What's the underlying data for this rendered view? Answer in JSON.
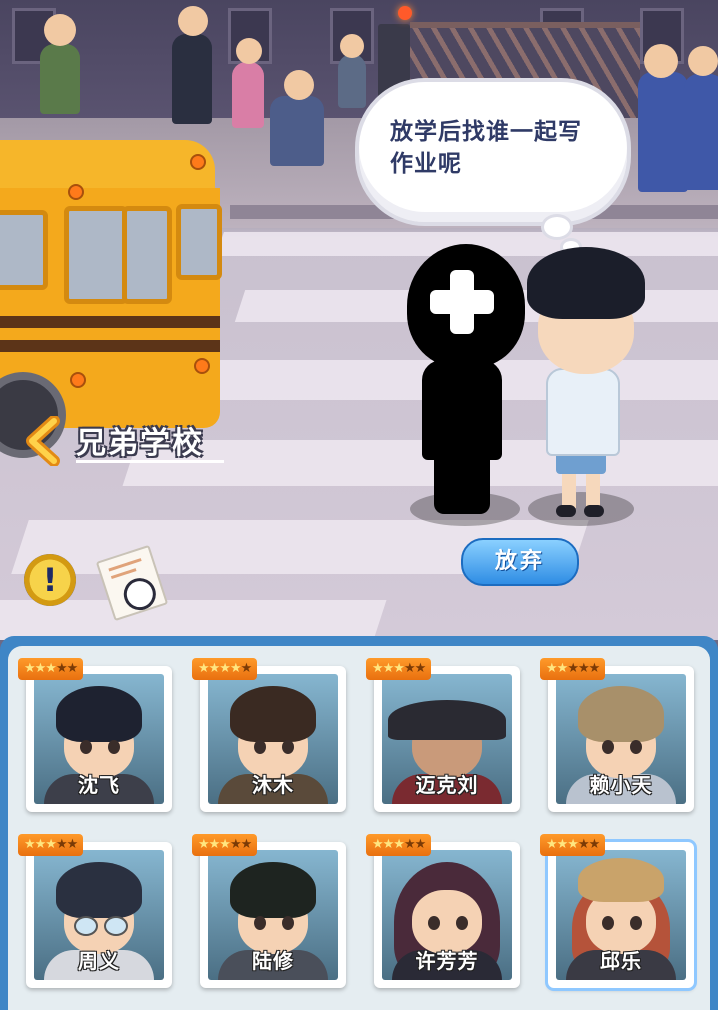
{
  "scene": {
    "location_label": "兄弟学校",
    "speech_bubble": "放学后找谁一起写作业呢",
    "give_up_label": "放弃",
    "info_button": "!"
  },
  "characters": [
    {
      "name": "沈飞",
      "stars": 5,
      "filled": 3
    },
    {
      "name": "沐木",
      "stars": 5,
      "filled": 4
    },
    {
      "name": "迈克刘",
      "stars": 5,
      "filled": 3
    },
    {
      "name": "赖小天",
      "stars": 5,
      "filled": 2
    },
    {
      "name": "周义",
      "stars": 5,
      "filled": 3
    },
    {
      "name": "陆修",
      "stars": 5,
      "filled": 3
    },
    {
      "name": "许芳芳",
      "stars": 5,
      "filled": 3
    },
    {
      "name": "邱乐",
      "stars": 5,
      "filled": 3
    }
  ],
  "colors": {
    "panel_frame": "#3f86c6",
    "panel_bg": "#e5edf1",
    "star_badge": "#ff9a2a",
    "give_up_button": "#2f8de4",
    "bubble_text": "#2f3a66"
  },
  "icons": {
    "back": "chevron-left-icon",
    "info": "exclamation-icon",
    "task": "task-sheet-icon",
    "add": "plus-icon"
  }
}
